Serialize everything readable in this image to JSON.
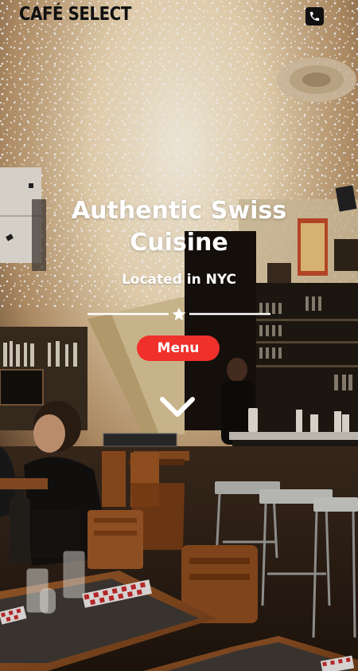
{
  "header": {
    "brand": "CAFÉ SELECT",
    "phone_icon": "phone-icon"
  },
  "hero": {
    "headline_line1": "Authentic Swiss",
    "headline_line2": "Cuisine",
    "subheadline": "Located in NYC",
    "divider_icon": "star-icon",
    "menu_button_label": "Menu",
    "scroll_icon": "chevron-down-icon"
  },
  "colors": {
    "brand_text": "#111111",
    "accent_button": "#f0302b",
    "hero_text": "#ffffff"
  }
}
